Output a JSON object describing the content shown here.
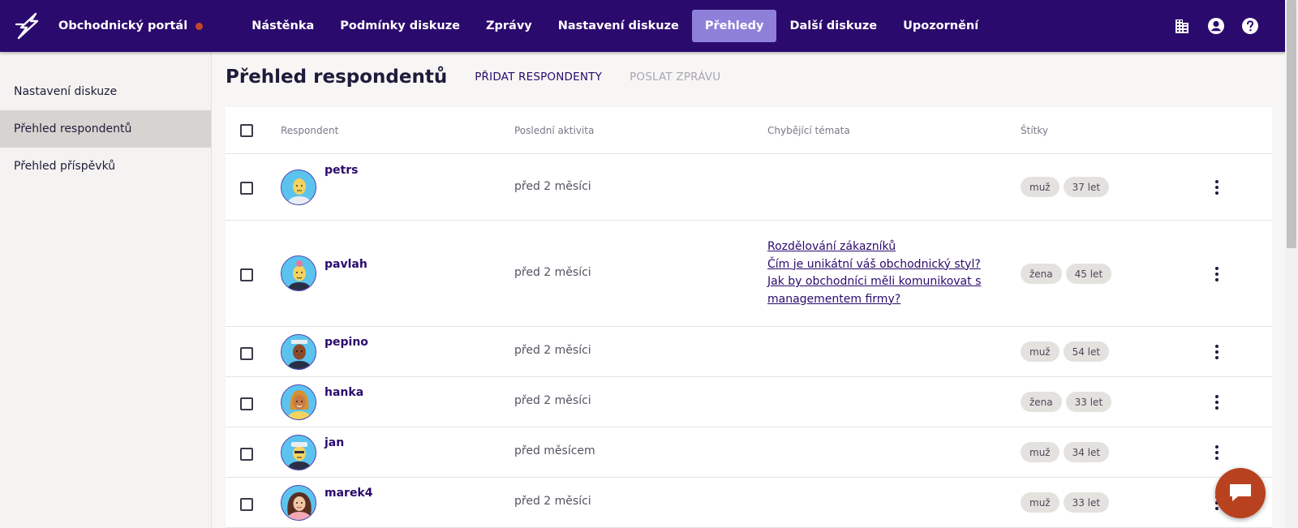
{
  "brand": {
    "name": "Obchodnický portál",
    "status_color": "#c2462b"
  },
  "nav": [
    {
      "label": "Nástěnka",
      "active": false
    },
    {
      "label": "Podmínky diskuze",
      "active": false
    },
    {
      "label": "Zprávy",
      "active": false
    },
    {
      "label": "Nastavení diskuze",
      "active": false
    },
    {
      "label": "Přehledy",
      "active": true
    },
    {
      "label": "Další diskuze",
      "active": false
    },
    {
      "label": "Upozornění",
      "active": false
    }
  ],
  "top_icons": [
    "building-icon",
    "account-icon",
    "help-icon"
  ],
  "sidebar": {
    "items": [
      {
        "label": "Nastavení diskuze",
        "active": false
      },
      {
        "label": "Přehled respondentů",
        "active": true
      },
      {
        "label": "Přehled příspěvků",
        "active": false
      }
    ]
  },
  "page": {
    "title": "Přehled respondentů",
    "add_button": "PŘIDAT RESPONDENTY",
    "message_button": "POSLAT ZPRÁVU"
  },
  "table": {
    "headers": {
      "respondent": "Respondent",
      "activity": "Poslední aktivita",
      "topics": "Chybějící témata",
      "tags": "Štítky"
    },
    "rows": [
      {
        "name": "petrs",
        "activity": "před 2 měsíci",
        "topics": [],
        "tags": [
          "muž",
          "37 let"
        ]
      },
      {
        "name": "pavlah",
        "activity": "před 2 měsíci",
        "topics": [
          "Rozdělování zákazníků",
          "Čím je unikátní váš obchodnický styl?",
          "Jak by obchodníci měli komunikovat s",
          "managementem firmy?"
        ],
        "tags": [
          "žena",
          "45 let"
        ]
      },
      {
        "name": "pepino",
        "activity": "před 2 měsíci",
        "topics": [],
        "tags": [
          "muž",
          "54 let"
        ]
      },
      {
        "name": "hanka",
        "activity": "před 2 měsíci",
        "topics": [],
        "tags": [
          "žena",
          "33 let"
        ]
      },
      {
        "name": "jan",
        "activity": "před měsícem",
        "topics": [],
        "tags": [
          "muž",
          "34 let"
        ]
      },
      {
        "name": "marek4",
        "activity": "před 2 měsíci",
        "topics": [],
        "tags": [
          "muž",
          "33 let"
        ]
      }
    ]
  },
  "colors": {
    "topbar": "#2b0a6e",
    "nav_active": "#8e80d9",
    "chat_button": "#b8421f"
  }
}
